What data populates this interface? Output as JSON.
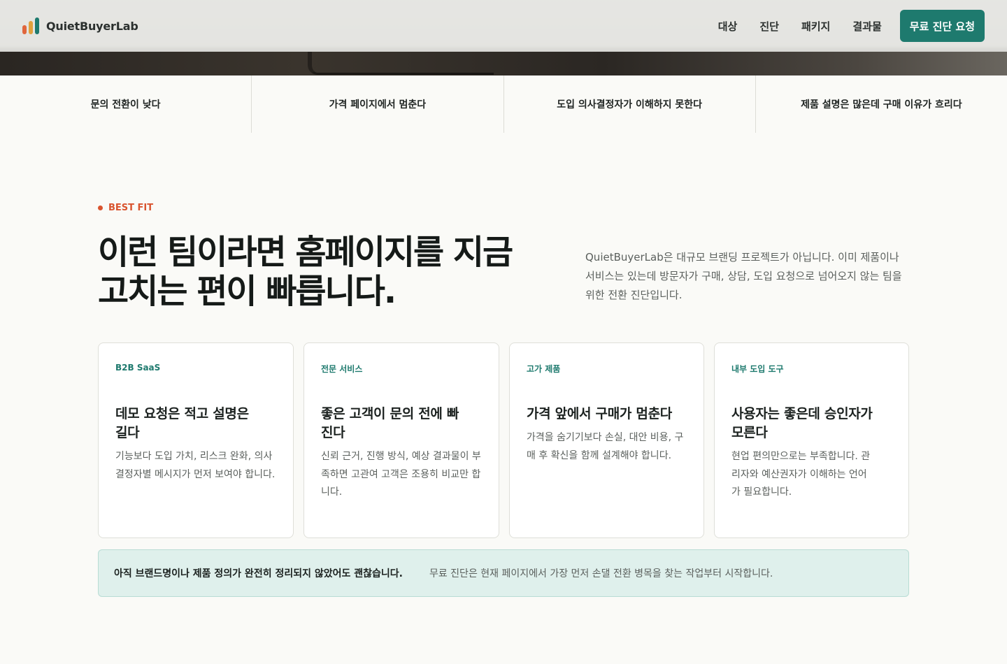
{
  "header": {
    "brand": "QuietBuyerLab",
    "nav": [
      "대상",
      "진단",
      "패키지",
      "결과물"
    ],
    "cta": "무료 진단 요청"
  },
  "pain_points": [
    "문의 전환이 낮다",
    "가격 페이지에서 멈춘다",
    "도입 의사결정자가 이해하지 못한다",
    "제품 설명은 많은데 구매 이유가 흐리다"
  ],
  "section": {
    "eyebrow": "BEST FIT",
    "headline_line1": "이런 팀이라면 홈페이지를 지금",
    "headline_line2": "고치는 편이 빠릅니다.",
    "intro": "QuietBuyerLab은 대규모 브랜딩 프로젝트가 아닙니다. 이미 제품이나 서비스는 있는데 방문자가 구매, 상담, 도입 요청으로 넘어오지 않는 팀을 위한 전환 진단입니다."
  },
  "cards": [
    {
      "tag": "B2B SaaS",
      "title": "데모 요청은 적고 설명은 길다",
      "text": "기능보다 도입 가치, 리스크 완화, 의사결정자별 메시지가 먼저 보여야 합니다."
    },
    {
      "tag": "전문 서비스",
      "title": "좋은 고객이 문의 전에 빠진다",
      "text": "신뢰 근거, 진행 방식, 예상 결과물이 부족하면 고관여 고객은 조용히 비교만 합니다."
    },
    {
      "tag": "고가 제품",
      "title": "가격 앞에서 구매가 멈춘다",
      "text": "가격을 숨기기보다 손실, 대안 비용, 구매 후 확신을 함께 설계해야 합니다."
    },
    {
      "tag": "내부 도입 도구",
      "title": "사용자는 좋은데 승인자가 모른다",
      "text": "현업 편의만으로는 부족합니다. 관리자와 예산권자가 이해하는 언어가 필요합니다."
    }
  ],
  "note": {
    "strong": "아직 브랜드명이나 제품 정의가 완전히 정리되지 않았어도 괜찮습니다.",
    "text": "무료 진단은 현재 페이지에서 가장 먼저 손댈 전환 병목을 찾는 작업부터 시작합니다."
  },
  "colors": {
    "accent": "#1e7a6e",
    "eyebrow": "#d9542f",
    "note_bg": "#dff0ec"
  }
}
